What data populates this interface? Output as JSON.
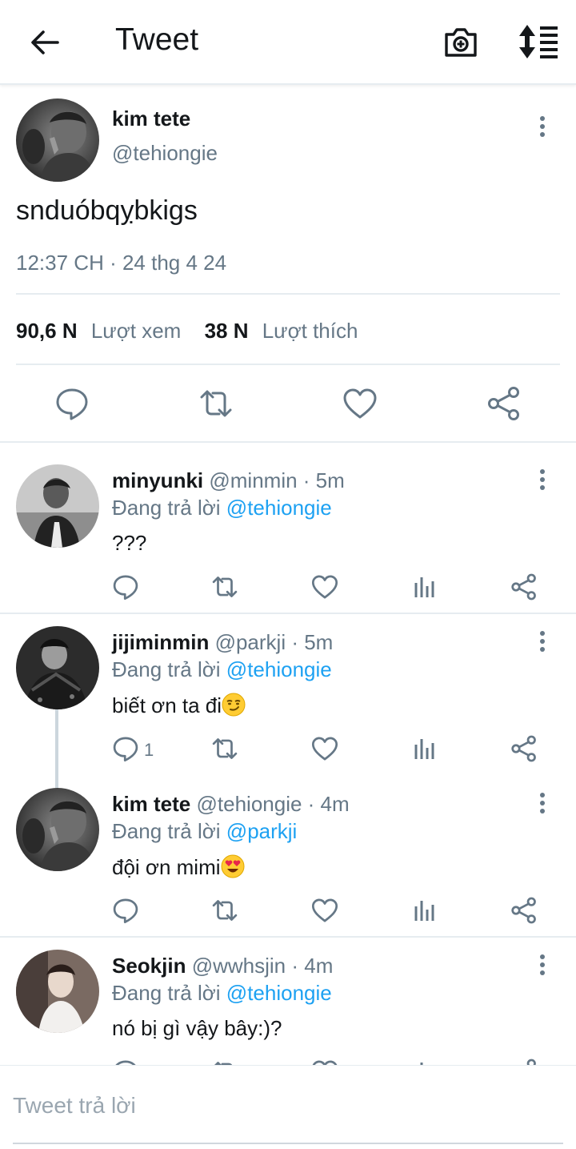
{
  "header": {
    "title": "Tweet"
  },
  "main_tweet": {
    "author_name": "kim tete",
    "author_handle": "@tehiongie",
    "text": "snduóbqỵbkigs",
    "timestamp": "12:37 CH · 24 thg 4 24",
    "views_count": "90,6 N",
    "views_label": "Lượt xem",
    "likes_count": "38 N",
    "likes_label": "Lượt thích"
  },
  "replies": [
    {
      "name": "minyunki",
      "handle": "@minmin · 5m",
      "replying_prefix": "Đang trả lời",
      "replying_to": "@tehiongie",
      "text": "???",
      "reply_count": ""
    },
    {
      "name": "jijiminmin",
      "handle": "@parkji · 5m",
      "replying_prefix": "Đang trả lời",
      "replying_to": "@tehiongie",
      "text": "biết ơn ta đi",
      "emoji": "smirk",
      "reply_count": "1"
    },
    {
      "name": "kim tete",
      "handle": "@tehiongie · 4m",
      "replying_prefix": "Đang trả lời",
      "replying_to": "@parkji",
      "text": "đội ơn mimi",
      "emoji": "heart-eyes",
      "reply_count": ""
    },
    {
      "name": "Seokjin",
      "handle": "@wwhsjin · 4m",
      "replying_prefix": "Đang trả lời",
      "replying_to": "@tehiongie",
      "text": "nó bị gì vậy bây:)?",
      "reply_count": ""
    }
  ],
  "composer": {
    "placeholder": "Tweet trả lời"
  },
  "colors": {
    "accent": "#1da1f2",
    "secondary_text": "#657786",
    "divider": "#e6ecf0",
    "icon_gray": "#657786"
  }
}
